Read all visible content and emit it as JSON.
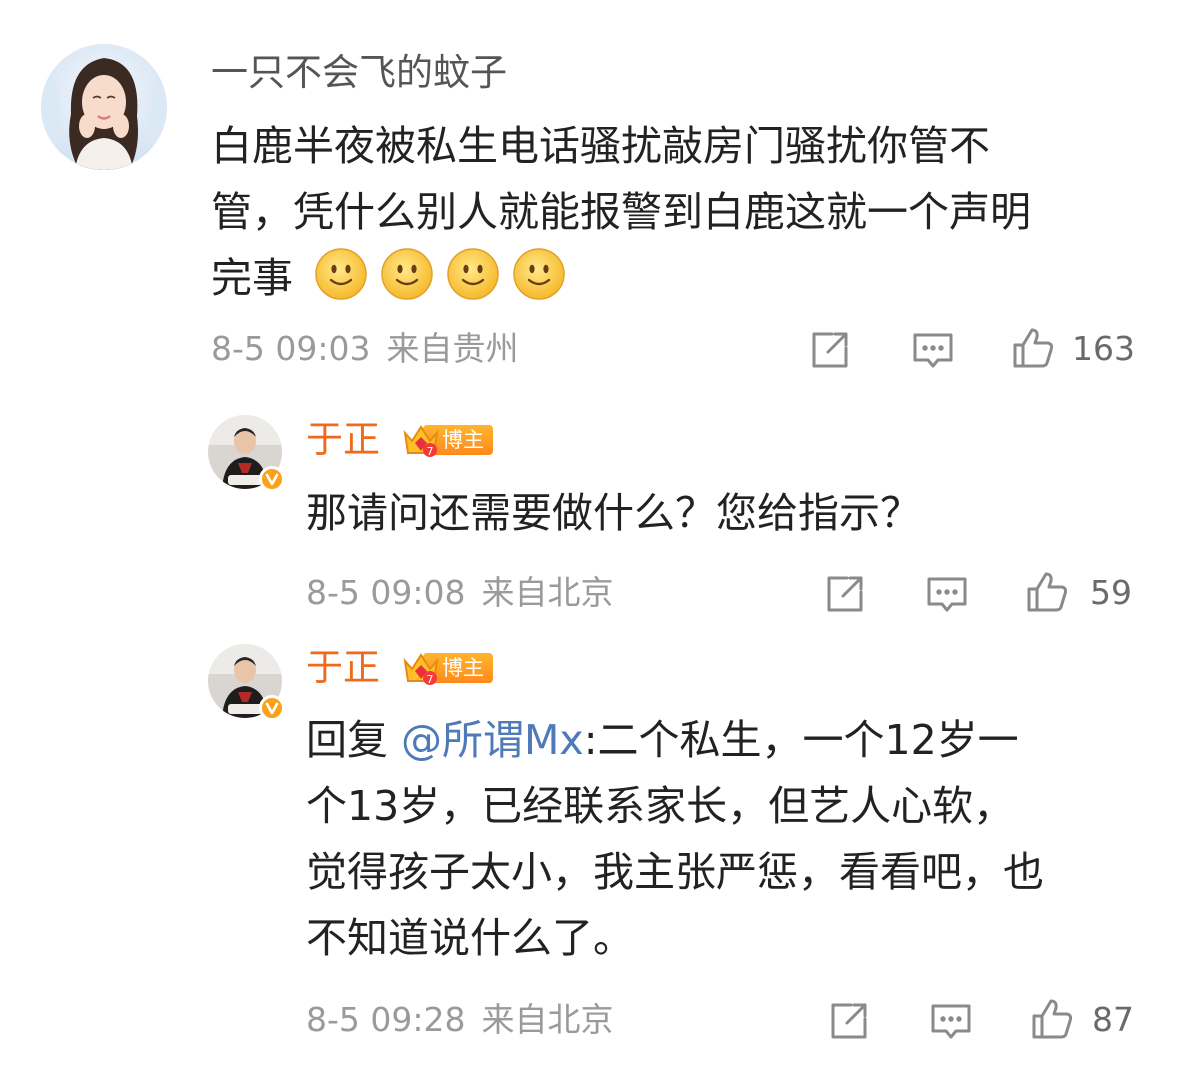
{
  "comments": [
    {
      "username": "一只不会飞的蚊子",
      "content_lines": [
        "白鹿半夜被私生电话骚扰敲房门骚扰你管不",
        "管，凭什么别人就能报警到白鹿这就一个声明",
        "完事"
      ],
      "emoji": "smile-emoji",
      "date": "8-5 09:03",
      "location": "来自贵州",
      "likes": "163"
    }
  ],
  "replies": [
    {
      "username": "于正",
      "badge": "博主",
      "content_lines": [
        "那请问还需要做什么？您给指示？"
      ],
      "date": "8-5 09:08",
      "location": "来自北京",
      "likes": "59"
    },
    {
      "username": "于正",
      "badge": "博主",
      "reply_prefix": "回复",
      "mention": "@所谓Mx",
      "content_lines": [
        ":二个私生，一个12岁一",
        "个13岁，已经联系家长，但艺人心软，",
        "觉得孩子太小，我主张严惩，看看吧，也",
        "不知道说什么了。"
      ],
      "date": "8-5 09:28",
      "location": "来自北京",
      "likes": "87"
    }
  ],
  "icons": {
    "share": "share-icon",
    "comment": "comment-icon",
    "like": "thumbs-up-icon",
    "verified": "verified-badge-icon",
    "crown": "crown-icon"
  },
  "colors": {
    "blogger_name": "#ef6a1b",
    "mention": "#4e7ab8",
    "meta": "#9a9a9a",
    "badge": "#ff9a22"
  }
}
